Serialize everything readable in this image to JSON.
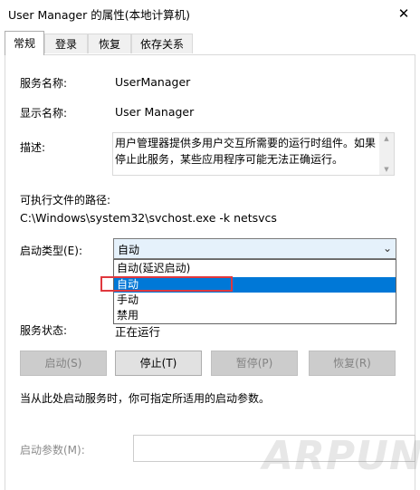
{
  "window": {
    "title": "User Manager 的属性(本地计算机)",
    "close_glyph": "✕"
  },
  "tabs": [
    {
      "label": "常规"
    },
    {
      "label": "登录"
    },
    {
      "label": "恢复"
    },
    {
      "label": "依存关系"
    }
  ],
  "general": {
    "service_name_label": "服务名称:",
    "service_name_value": "UserManager",
    "display_name_label": "显示名称:",
    "display_name_value": "User Manager",
    "description_label": "描述:",
    "description_value": "用户管理器提供多用户交互所需要的运行时组件。如果停止此服务，某些应用程序可能无法正确运行。",
    "path_label": "可执行文件的路径:",
    "path_value": "C:\\Windows\\system32\\svchost.exe -k netsvcs",
    "startup_type_label": "启动类型(E):",
    "startup_type_value": "自动",
    "startup_options": [
      "自动(延迟启动)",
      "自动",
      "手动",
      "禁用"
    ],
    "startup_selected_index": 1,
    "status_label": "服务状态:",
    "status_value": "正在运行",
    "start_button": "启动(S)",
    "stop_button": "停止(T)",
    "pause_button": "暂停(P)",
    "resume_button": "恢复(R)",
    "hint_text": "当从此处启动服务时，你可指定所适用的启动参数。",
    "param_label": "启动参数(M):"
  },
  "watermark": "ARPUN.COM",
  "colors": {
    "selection": "#0078d7",
    "highlight_border": "#e0383e",
    "combo_background": "#e5f1fb"
  },
  "icons": {
    "close": "close-icon",
    "combo_arrow": "chevron-down-icon",
    "scroll_up": "scroll-up-icon",
    "scroll_down": "scroll-down-icon"
  }
}
